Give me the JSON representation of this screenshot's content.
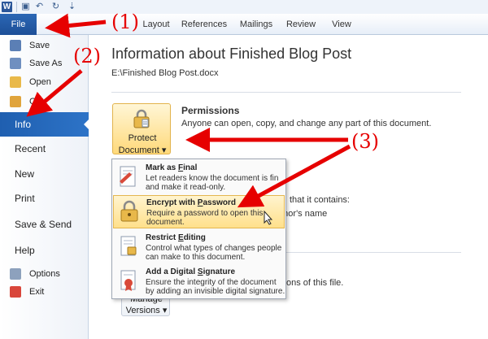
{
  "app": {
    "logo": "W",
    "quick_access": [
      "save-icon",
      "undo-icon",
      "redo-icon",
      "customize-icon"
    ]
  },
  "ribbon": {
    "file_tab": "File",
    "tabs": [
      "Layout",
      "References",
      "Mailings",
      "Review",
      "View"
    ]
  },
  "nav": {
    "small_items": [
      {
        "label": "Save",
        "icon": "save-icon"
      },
      {
        "label": "Save As",
        "icon": "save-as-icon"
      },
      {
        "label": "Open",
        "icon": "open-folder-icon"
      },
      {
        "label": "Cl",
        "icon": "close-icon"
      }
    ],
    "big_items": [
      "Info",
      "Recent",
      "New",
      "Print",
      "Save & Send",
      "Help"
    ],
    "active": "Info",
    "bottom_items": [
      {
        "label": "Options",
        "icon": "options-icon"
      },
      {
        "label": "Exit",
        "icon": "exit-icon"
      }
    ]
  },
  "main": {
    "title": "Information about Finished Blog Post",
    "path": "E:\\Finished Blog Post.docx",
    "protect_button": {
      "line1": "Protect",
      "line2": "Document ▾"
    },
    "permissions": {
      "title": "Permissions",
      "description": "Anyone can open, copy, and change any part of this document."
    },
    "partial_texts": {
      "contains": "that it contains:",
      "author": "uthor's name",
      "versions": "ons of this file."
    },
    "manage_button": {
      "line1": "Manage",
      "line2": "Versions ▾"
    }
  },
  "menu": {
    "items": [
      {
        "title": "Mark as Final",
        "title_plain": "Mark as ",
        "title_u": "F",
        "title_rest": "inal",
        "line1": "Let readers know the document is fin",
        "line2": "and make it read-only.",
        "highlighted": false
      },
      {
        "title": "Encrypt with Password",
        "title_plain": "Encrypt with ",
        "title_u": "P",
        "title_rest": "assword",
        "line1": "Require a password to open this",
        "line2": "document.",
        "highlighted": true
      },
      {
        "title": "Restrict Editing",
        "title_plain": "Restrict ",
        "title_u": "E",
        "title_rest": "diting",
        "line1": "Control what types of changes people",
        "line2": "can make to this document.",
        "highlighted": false
      },
      {
        "title": "Add a Digital Signature",
        "title_plain": "Add a Digital ",
        "title_u": "S",
        "title_rest": "ignature",
        "line1": "Ensure the integrity of the document",
        "line2": "by adding an invisible digital signature.",
        "highlighted": false
      }
    ]
  },
  "annotations": {
    "step1": "(1)",
    "step2": "(2)",
    "step3": "(3)",
    "color": "#e60000"
  }
}
